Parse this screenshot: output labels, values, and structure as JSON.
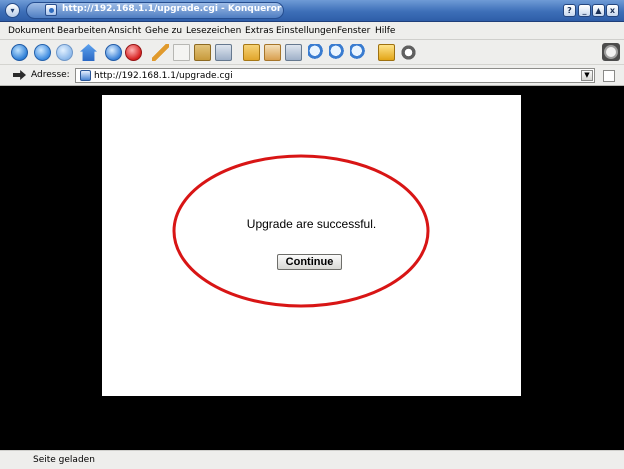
{
  "window": {
    "title": "http://192.168.1.1/upgrade.cgi - Konqueror",
    "buttons": {
      "help": "?",
      "minimize": "_",
      "maximize": "▲",
      "close": "x"
    }
  },
  "menubar": {
    "items": [
      "Dokument",
      "Bearbeiten",
      "Ansicht",
      "Gehe zu",
      "Lesezeichen",
      "Extras",
      "Einstellungen",
      "Fenster",
      "Hilfe"
    ]
  },
  "toolbar": {
    "icons": [
      "up-arrow-icon",
      "back-arrow-icon",
      "forward-arrow-icon",
      "home-icon",
      "reload-icon",
      "stop-icon",
      "cut-icon",
      "copy-icon",
      "paste-icon",
      "print-icon",
      "folder-icon",
      "trash-icon",
      "bookmark-icon",
      "zoom-fit-icon",
      "zoom-in-icon",
      "zoom-out-icon",
      "lock-icon",
      "info-icon",
      "gear-icon"
    ]
  },
  "address": {
    "label": "Adresse:",
    "url": "http://192.168.1.1/upgrade.cgi"
  },
  "page": {
    "message": "Upgrade are successful.",
    "continue_label": "Continue",
    "highlight_color": "#d81515"
  },
  "status": {
    "text": "Seite geladen"
  }
}
